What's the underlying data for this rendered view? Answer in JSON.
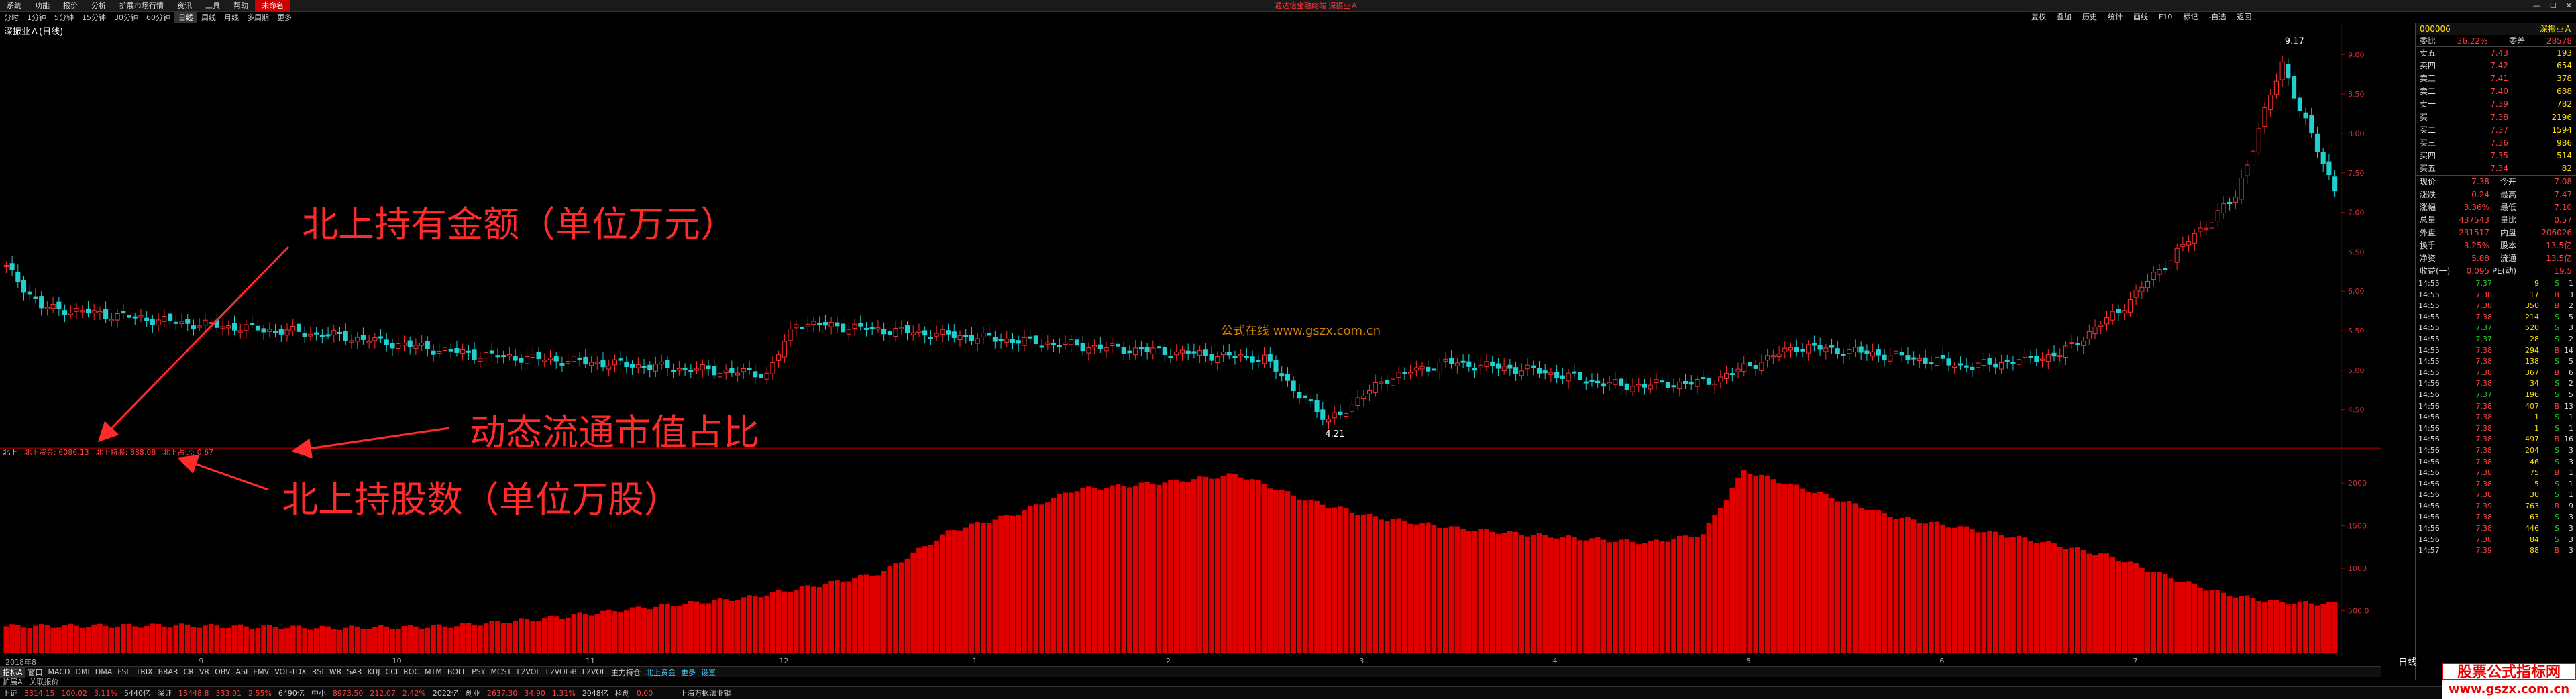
{
  "menu": {
    "items": [
      "系统",
      "功能",
      "报价",
      "分析",
      "扩展市场行情",
      "资讯",
      "工具",
      "帮助",
      "未命名"
    ],
    "title": "通达信金融终端 深振业Ａ"
  },
  "period": {
    "items": [
      "分时",
      "1分钟",
      "5分钟",
      "15分钟",
      "30分钟",
      "60分钟",
      "日线",
      "周线",
      "月线",
      "多周期",
      "更多"
    ],
    "active_index": 6
  },
  "toolbar": [
    "复权",
    "叠加",
    "历史",
    "统计",
    "画线",
    "F10",
    "标记",
    "-自选",
    "返回"
  ],
  "chart": {
    "title": "深振业Ａ(日线)",
    "watermark": "公式在线 www.gszx.com.cn",
    "price_axis": [
      "9.00",
      "8.50",
      "8.00",
      "7.50",
      "7.00",
      "6.50",
      "6.00",
      "5.50",
      "5.00",
      "4.50"
    ],
    "price_values": [
      9.0,
      8.5,
      8.0,
      7.5,
      7.0,
      6.5,
      6.0,
      5.5,
      5.0,
      4.5
    ],
    "high_label": "9.17",
    "low_label": "4.21",
    "ylim": [
      4.2,
      9.3
    ],
    "up_color": "#ff3030",
    "down_color": "#20d0d0"
  },
  "indicator": {
    "name": "北上",
    "fund_label": "北上资金:",
    "fund_value": "6086.13",
    "hold_label": "北上持股:",
    "hold_value": "888.08",
    "ratio_label": "北上占比:",
    "ratio_value": "0.67",
    "axis": [
      "2000",
      "1500",
      "1000",
      "500.0"
    ],
    "axis_values": [
      2000,
      1500,
      1000,
      500
    ],
    "bar_color": "#e00000"
  },
  "annotations": {
    "a1": "北上持有金额（单位万元）",
    "a2": "动态流通市值占比",
    "a3": "北上持股数（单位万股）"
  },
  "dates": {
    "labels": [
      "2018年8",
      "9",
      "10",
      "11",
      "12",
      "1",
      "2",
      "3",
      "4",
      "5",
      "6",
      "7"
    ]
  },
  "tabs": [
    "指标A",
    "窗口",
    "MACD",
    "DMI",
    "DMA",
    "FSL",
    "TRIX",
    "BRAR",
    "CR",
    "VR",
    "OBV",
    "ASI",
    "EMV",
    "VOL-TDX",
    "RSI",
    "WR",
    "SAR",
    "KDJ",
    "CCI",
    "ROC",
    "MTM",
    "BOLL",
    "PSY",
    "MCST",
    "L2VOL",
    "L2VOL-B",
    "L2VOL",
    "主力持仓",
    "北上资金",
    "更多",
    "设置"
  ],
  "status1": [
    "扩展A",
    "关联报价"
  ],
  "status2": {
    "items": [
      {
        "n": "上证",
        "v": "3314.15",
        "c": "100.02",
        "p": "3.11%",
        "a": "5440亿"
      },
      {
        "n": "深证",
        "v": "13448.8",
        "c": "333.01",
        "p": "2.55%",
        "a": "6490亿"
      },
      {
        "n": "中小",
        "v": "8973.50",
        "c": "212.07",
        "p": "2.42%",
        "a": "2022亿"
      },
      {
        "n": "创业",
        "v": "2637.30",
        "c": "34.90",
        "p": "1.31%",
        "a": "2048亿"
      },
      {
        "n": "科创",
        "v": "0.00",
        "c": "",
        "p": "",
        "a": ""
      }
    ],
    "ticker": "上海万枫法业钢"
  },
  "panel": {
    "code": "000006",
    "name": "深振业Ａ",
    "webi": "委比",
    "webi_v": "36.22%",
    "wc": "委差",
    "wc_v": "28578",
    "sells": [
      {
        "l": "卖五",
        "p": "7.43",
        "v": "193"
      },
      {
        "l": "卖四",
        "p": "7.42",
        "v": "654"
      },
      {
        "l": "卖三",
        "p": "7.41",
        "v": "378"
      },
      {
        "l": "卖二",
        "p": "7.40",
        "v": "688"
      },
      {
        "l": "卖一",
        "p": "7.39",
        "v": "782"
      }
    ],
    "buys": [
      {
        "l": "买一",
        "p": "7.38",
        "v": "2196"
      },
      {
        "l": "买二",
        "p": "7.37",
        "v": "1594"
      },
      {
        "l": "买三",
        "p": "7.36",
        "v": "986"
      },
      {
        "l": "买四",
        "p": "7.35",
        "v": "514"
      },
      {
        "l": "买五",
        "p": "7.34",
        "v": "82"
      }
    ],
    "quote": [
      {
        "a": "现价",
        "b": "7.38",
        "c": "今开",
        "d": "7.08"
      },
      {
        "a": "涨跌",
        "b": "0.24",
        "c": "最高",
        "d": "7.47"
      },
      {
        "a": "涨幅",
        "b": "3.36%",
        "c": "最低",
        "d": "7.10"
      },
      {
        "a": "总量",
        "b": "437543",
        "c": "量比",
        "d": "0.57"
      },
      {
        "a": "外盘",
        "b": "231517",
        "c": "内盘",
        "d": "206026"
      },
      {
        "a": "换手",
        "b": "3.25%",
        "c": "股本",
        "d": "13.5亿"
      },
      {
        "a": "净资",
        "b": "5.88",
        "c": "流通",
        "d": "13.5亿"
      },
      {
        "a": "收益(一)",
        "b": "0.095",
        "c": "PE(动)",
        "d": "19.5"
      }
    ],
    "ticks": [
      [
        "14:55",
        "7.37",
        "9",
        "S",
        "1"
      ],
      [
        "14:55",
        "7.38",
        "17",
        "B",
        "3"
      ],
      [
        "14:55",
        "7.38",
        "350",
        "B",
        "2"
      ],
      [
        "14:55",
        "7.38",
        "214",
        "S",
        "5"
      ],
      [
        "14:55",
        "7.37",
        "520",
        "S",
        "3"
      ],
      [
        "14:55",
        "7.37",
        "28",
        "S",
        "2"
      ],
      [
        "14:55",
        "7.38",
        "294",
        "B",
        "14"
      ],
      [
        "14:55",
        "7.38",
        "138",
        "S",
        "5"
      ],
      [
        "14:55",
        "7.38",
        "367",
        "B",
        "6"
      ],
      [
        "14:56",
        "7.38",
        "34",
        "S",
        "2"
      ],
      [
        "14:56",
        "7.37",
        "196",
        "S",
        "5"
      ],
      [
        "14:56",
        "7.38",
        "407",
        "B",
        "13"
      ],
      [
        "14:56",
        "7.38",
        "1",
        "S",
        "1"
      ],
      [
        "14:56",
        "7.38",
        "1",
        "S",
        "1"
      ],
      [
        "14:56",
        "7.38",
        "497",
        "B",
        "16"
      ],
      [
        "14:56",
        "7.38",
        "204",
        "S",
        "3"
      ],
      [
        "14:56",
        "7.38",
        "46",
        "S",
        "3"
      ],
      [
        "14:56",
        "7.38",
        "75",
        "B",
        "1"
      ],
      [
        "14:56",
        "7.38",
        "5",
        "S",
        "1"
      ],
      [
        "14:56",
        "7.38",
        "30",
        "S",
        "1"
      ],
      [
        "14:56",
        "7.39",
        "763",
        "B",
        "9"
      ],
      [
        "14:56",
        "7.38",
        "63",
        "S",
        "3"
      ],
      [
        "14:56",
        "7.38",
        "446",
        "S",
        "3"
      ],
      [
        "14:56",
        "7.38",
        "84",
        "S",
        "3"
      ],
      [
        "14:57",
        "7.39",
        "88",
        "B",
        "3"
      ]
    ],
    "watermark": "股票公式指标网",
    "watermark_url": "www.gszx.com.cn",
    "period_tag": "日线"
  }
}
